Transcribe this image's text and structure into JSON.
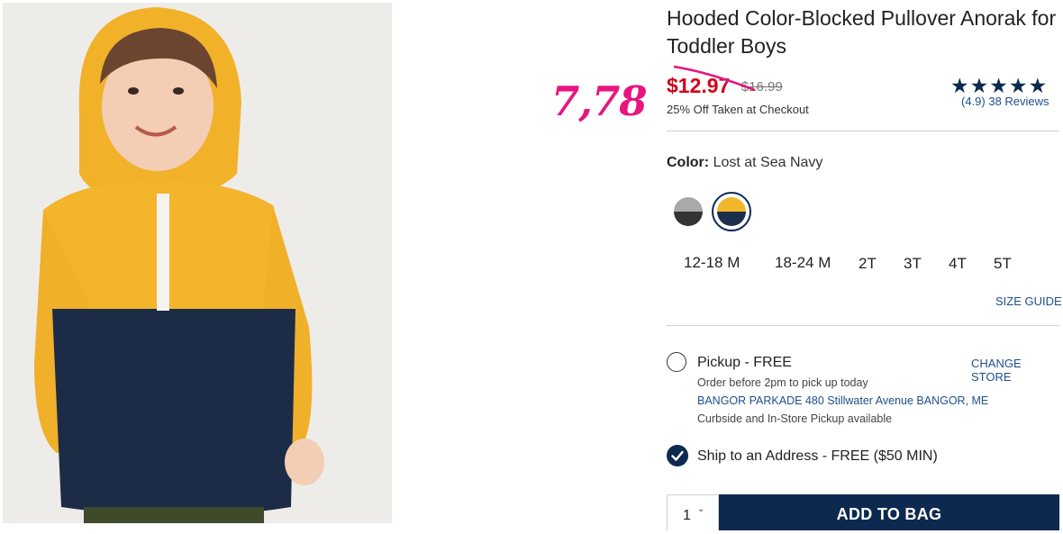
{
  "product": {
    "title": "Hooded Color-Blocked Pullover Anorak for Toddler Boys",
    "image_alt": "Toddler boy wearing yellow and navy hooded pullover anorak"
  },
  "annotation": {
    "text": "7,78",
    "color": "#e8157f"
  },
  "pricing": {
    "sale_price": "$12.97",
    "original_price": "$16.99",
    "promo": "25% Off Taken at Checkout"
  },
  "rating": {
    "stars": "★★★★★",
    "value": 4.9,
    "reviews_text": "(4.9) 38 Reviews"
  },
  "color": {
    "label": "Color:",
    "selected": "Lost at Sea Navy",
    "swatches": [
      {
        "icon": "gray-black-swatch",
        "top": "#a9a9a9",
        "bottom": "#333333",
        "selected": false
      },
      {
        "icon": "yellow-navy-swatch",
        "top": "#f1b62a",
        "bottom": "#1b2f4c",
        "selected": true
      }
    ]
  },
  "sizes": [
    "12-18 M",
    "18-24 M",
    "2T",
    "3T",
    "4T",
    "5T"
  ],
  "size_guide": "SIZE GUIDE",
  "fulfillment": {
    "pickup_title": "Pickup - FREE",
    "change_store": "CHANGE STORE",
    "pickup_note": "Order before 2pm to pick up today",
    "store_address": "BANGOR PARKADE 480 Stillwater Avenue  BANGOR, ME",
    "curbside": "Curbside and In-Store Pickup available",
    "ship_label": "Ship to an Address - FREE ($50 MIN)",
    "ship_selected": true
  },
  "cart": {
    "quantity": "1",
    "chevron": "⌄",
    "add_label": "ADD TO BAG"
  },
  "colors": {
    "navy": "#0c2a50",
    "link": "#1f4f8c",
    "sale_red": "#d0021b"
  }
}
